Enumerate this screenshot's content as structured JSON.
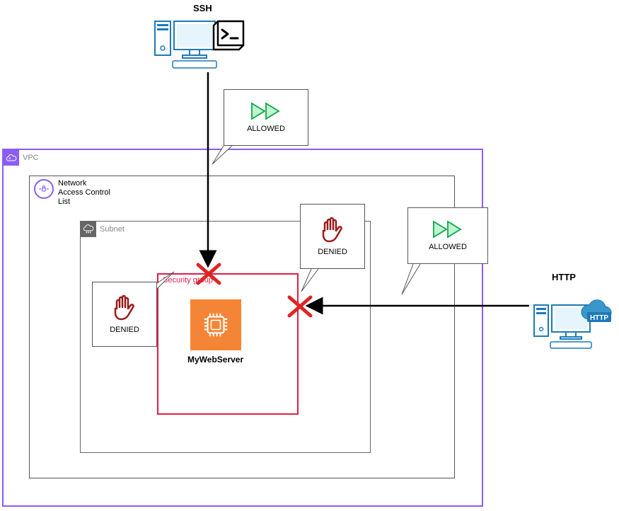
{
  "labels": {
    "ssh": "SSH",
    "http": "HTTP",
    "vpc": "VPC",
    "nacl": "Network\nAccess Control\nList",
    "subnet": "Subnet",
    "security_group": "Security group",
    "server": "MyWebServer",
    "allowed": "ALLOWED",
    "denied": "DENIED",
    "http_badge": "HTTP"
  },
  "colors": {
    "vpc_border": "#8b5cf6",
    "nacl_border": "#555555",
    "subnet_border": "#666666",
    "sg_border": "#e11d48",
    "allowed_icon": "#4ade80",
    "denied_icon": "#991b1b",
    "block_x": "#dc2626",
    "ec2_bg": "#f58536",
    "http_icon": "#1d7ab8"
  }
}
